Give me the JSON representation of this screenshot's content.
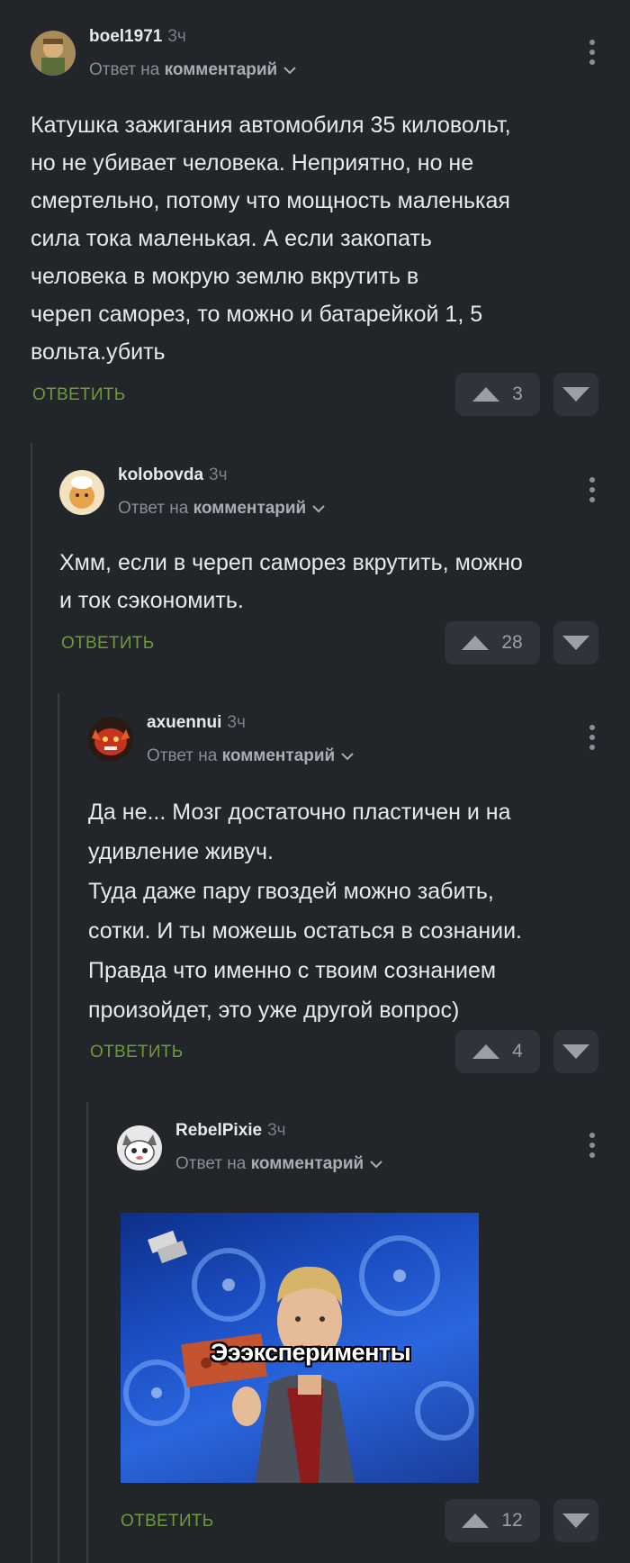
{
  "comments": [
    {
      "username": "boel1971",
      "time": "3ч",
      "reply_prefix": "Ответ на",
      "reply_target": "комментарий",
      "text_lines": [
        "Катушка зажигания автомобиля 35 киловольт,",
        "но не убивает человека. Неприятно, но не",
        "смертельно, потому что мощность маленькая",
        "сила тока маленькая. А если закопать",
        "человека в мокрую землю вкрутить в",
        "череп саморез, то можно и батарейкой 1, 5",
        "вольта.убить"
      ],
      "reply_label": "ОТВЕТИТЬ",
      "rating": "3"
    },
    {
      "username": "kolobovda",
      "time": "3ч",
      "reply_prefix": "Ответ на",
      "reply_target": "комментарий",
      "text_lines": [
        "Хмм, если в череп саморез вкрутить, можно",
        "и ток сэкономить."
      ],
      "reply_label": "ОТВЕТИТЬ",
      "rating": "28"
    },
    {
      "username": "axuennui",
      "time": "3ч",
      "reply_prefix": "Ответ на",
      "reply_target": "комментарий",
      "text_lines": [
        "Да не... Мозг достаточно пластичен и на",
        "удивление живуч.",
        "Туда даже пару гвоздей можно забить,",
        "сотки. И ты можешь остаться в сознании.",
        "Правда что именно с твоим сознанием",
        "произойдет, это уже другой вопрос)"
      ],
      "reply_label": "ОТВЕТИТЬ",
      "rating": "4"
    },
    {
      "username": "RebelPixie",
      "time": "3ч",
      "reply_prefix": "Ответ на",
      "reply_target": "комментарий",
      "image_caption": "Эээксперименты",
      "reply_label": "ОТВЕТИТЬ",
      "rating": "12"
    }
  ],
  "colors": {
    "background": "#222529",
    "accent_reply": "#6f9a3a",
    "vote_bg": "#30343a"
  }
}
